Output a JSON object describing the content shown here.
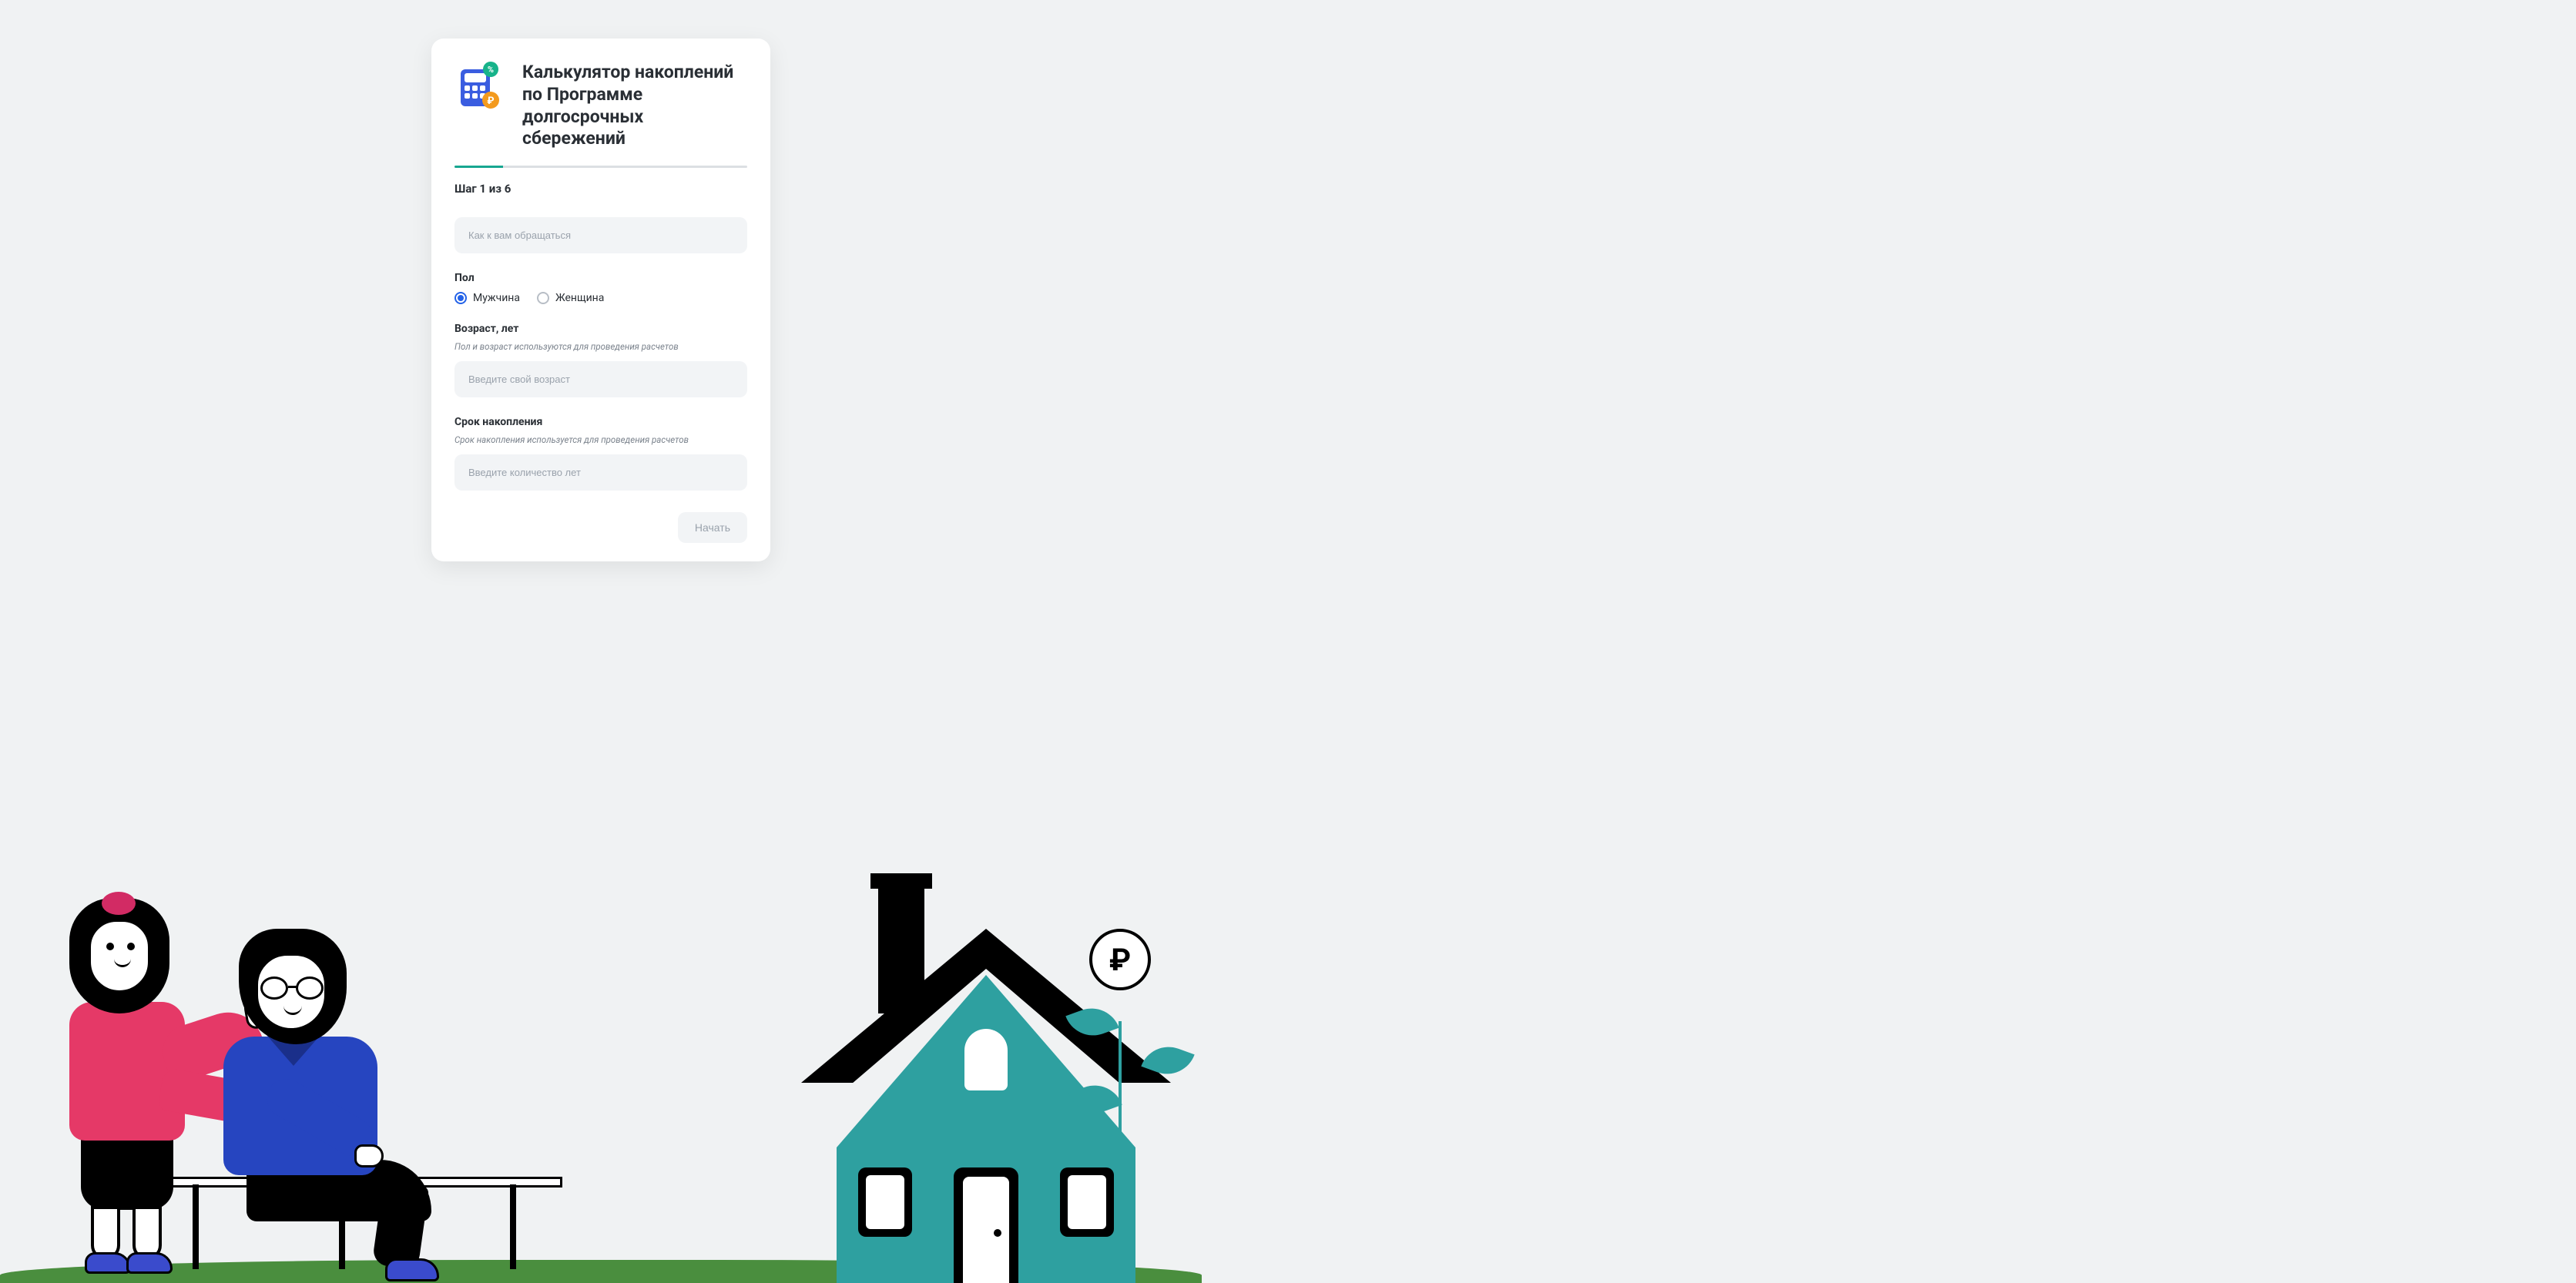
{
  "card": {
    "title": "Калькулятор накоплений по Программе долгосрочных сбережений",
    "step_label": "Шаг 1 из 6",
    "progress_percent": 16.66,
    "name_placeholder": "Как к вам обращаться",
    "gender": {
      "label": "Пол",
      "options": [
        "Мужчина",
        "Женщина"
      ],
      "selected": "Мужчина"
    },
    "age": {
      "label": "Возраст, лет",
      "hint": "Пол и возраст используются для проведения расчетов",
      "placeholder": "Введите свой возраст"
    },
    "term": {
      "label": "Срок накопления",
      "hint": "Срок накопления используется для проведения расчетов",
      "placeholder": "Введите количество лет"
    },
    "start_button": "Начать"
  },
  "ruble_symbol": "₽"
}
